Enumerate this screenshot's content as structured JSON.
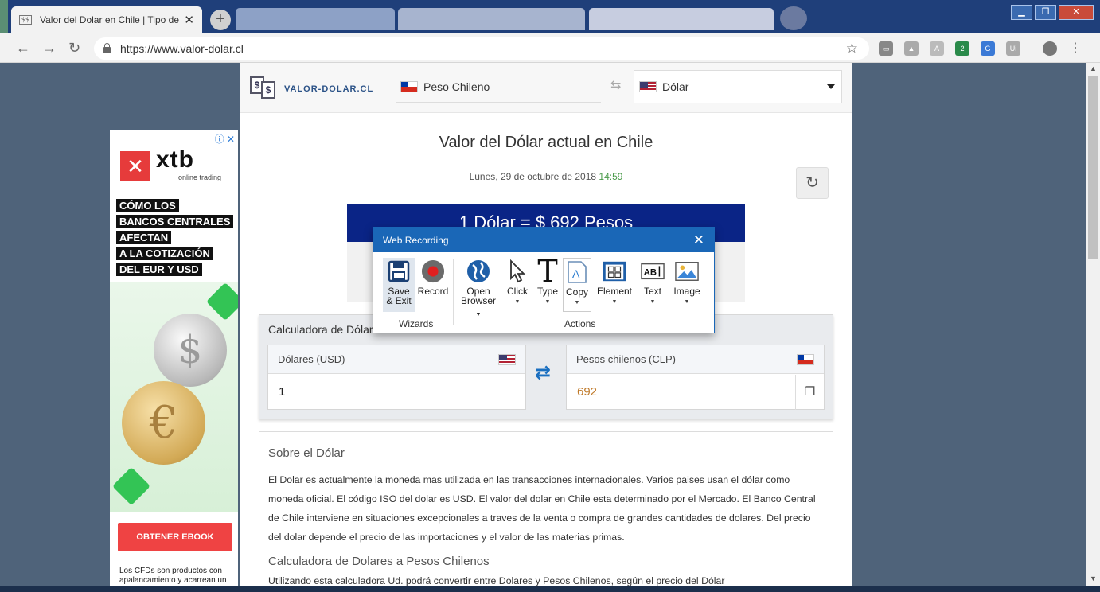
{
  "browser": {
    "active_tab": {
      "title": "Valor del Dolar en Chile | Tipo de",
      "favicon_text": "$$"
    },
    "url": "https://www.valor-dolar.cl",
    "ext_badge": "2",
    "ext_ui_label": "Ui"
  },
  "site": {
    "logo_text": "VALOR-DOLAR.CL",
    "currency_from": "Peso Chileno",
    "currency_to": "Dólar",
    "page_title": "Valor del Dólar actual en Chile",
    "date": "Lunes, 29 de octubre de 2018",
    "time": "14:59",
    "rate_banner": "1 Dólar = $ 692 Pesos",
    "calculator": {
      "title": "Calculadora de Dólar",
      "left_label": "Dólares (USD)",
      "left_value": "1",
      "right_label": "Pesos chilenos (CLP)",
      "right_value": "692"
    },
    "about": {
      "heading1": "Sobre el Dólar",
      "paragraph": "El Dolar es actualmente la moneda mas utilizada en las transacciones internacionales. Varios paises usan el dólar como moneda oficial. El código ISO del dolar es USD. El valor del dolar en Chile esta determinado por el Mercado. El Banco Central de Chile interviene en situaciones excepcionales a traves de la venta o compra de grandes cantidades de dolares. Del precio del dolar depende el precio de las importaciones y el valor de las materias primas.",
      "heading2": "Calculadora de Dolares a Pesos Chilenos",
      "cut_line": "Utilizando esta calculadora Ud. podrá convertir entre Dolares y Pesos Chilenos, según el precio del Dólar"
    }
  },
  "ad": {
    "brand": "xtb",
    "brand_sub": "online trading",
    "lines": [
      "CÓMO LOS",
      "BANCOS CENTRALES",
      "AFECTAN",
      "A LA COTIZACIÓN",
      "DEL EUR Y USD"
    ],
    "cta": "OBTENER EBOOK",
    "disclaimer": "Los CFDs son productos con apalancamiento y acarrean un",
    "info_icons": "ⓘ ✕"
  },
  "dialog": {
    "title": "Web Recording",
    "tools": {
      "save_exit_1": "Save",
      "save_exit_2": "& Exit",
      "record": "Record",
      "open_browser_1": "Open",
      "open_browser_2": "Browser",
      "click": "Click",
      "type": "Type",
      "copy": "Copy",
      "element": "Element",
      "text": "Text",
      "image": "Image"
    },
    "groups": {
      "wizards": "Wizards",
      "actions": "Actions"
    }
  },
  "colors": {
    "accent": "#1a67b7",
    "banner": "#0a2486",
    "clp_value": "#c07a2a",
    "time": "#4a9a4a",
    "record": "#e02020",
    "ad_cta": "#ef4343"
  }
}
